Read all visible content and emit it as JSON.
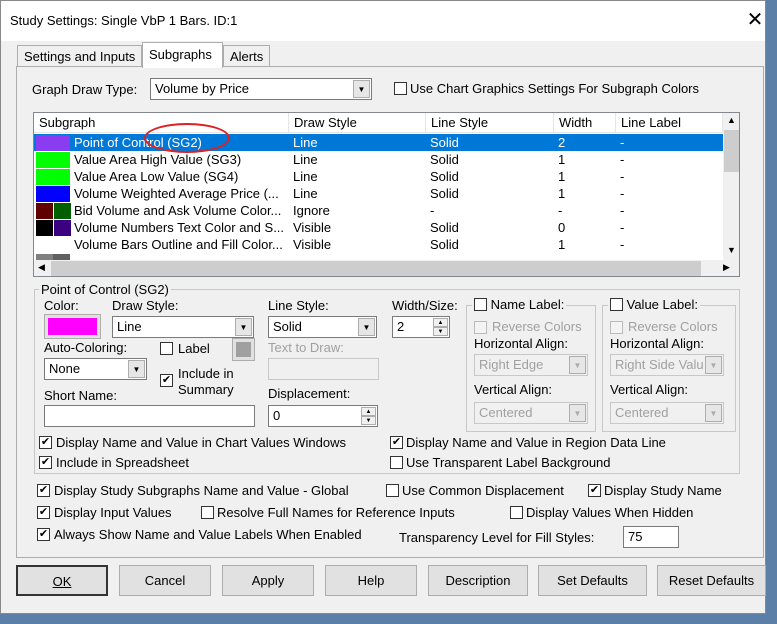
{
  "window": {
    "title": "Study Settings: Single VbP 1 Bars. ID:1"
  },
  "tabs": [
    {
      "label": "Settings and Inputs"
    },
    {
      "label": "Subgraphs",
      "selected": true
    },
    {
      "label": "Alerts"
    }
  ],
  "graph_draw_type": {
    "label": "Graph Draw Type:",
    "value": "Volume by Price"
  },
  "use_chart_graphics": {
    "label": "Use Chart Graphics Settings For Subgraph Colors",
    "checked": false
  },
  "list": {
    "columns": [
      "Subgraph",
      "Draw Style",
      "Line Style",
      "Width",
      "Line Label"
    ],
    "rows": [
      {
        "name": "Point of Control (SG2)",
        "draw": "Line",
        "line": "Solid",
        "width": "2",
        "label": "-",
        "colors": [
          "#8a3df0"
        ],
        "selected": true
      },
      {
        "name": "Value Area High Value (SG3)",
        "draw": "Line",
        "line": "Solid",
        "width": "1",
        "label": "-",
        "colors": [
          "#00ff00"
        ]
      },
      {
        "name": "Value Area Low Value (SG4)",
        "draw": "Line",
        "line": "Solid",
        "width": "1",
        "label": "-",
        "colors": [
          "#00ff00"
        ]
      },
      {
        "name": "Volume Weighted Average Price (...",
        "draw": "Line",
        "line": "Solid",
        "width": "1",
        "label": "-",
        "colors": [
          "#0000ff"
        ]
      },
      {
        "name": "Bid Volume and Ask Volume Color...",
        "draw": "Ignore",
        "line": "-",
        "width": "-",
        "label": "-",
        "colors": [
          "#600000",
          "#006000"
        ]
      },
      {
        "name": "Volume Numbers Text Color and S...",
        "draw": "Visible",
        "line": "Solid",
        "width": "0",
        "label": "-",
        "colors": [
          "#000000",
          "#3a0080"
        ]
      },
      {
        "name": "Volume Bars Outline and Fill Color...",
        "draw": "Visible",
        "line": "Solid",
        "width": "1",
        "label": "-",
        "colors": [
          "#ffffff",
          "#ffffff"
        ]
      }
    ]
  },
  "detail": {
    "group_title": "Point of Control (SG2)",
    "color_label": "Color:",
    "color": "#ff00ff",
    "draw_style_label": "Draw Style:",
    "draw_style": "Line",
    "line_style_label": "Line Style:",
    "line_style": "Solid",
    "width_label": "Width/Size:",
    "width": "2",
    "auto_coloring_label": "Auto-Coloring:",
    "auto_coloring": "None",
    "label_cb": "Label",
    "include_summary": "Include in Summary",
    "text_to_draw_label": "Text to Draw:",
    "short_name_label": "Short Name:",
    "short_name": "",
    "displacement_label": "Displacement:",
    "displacement": "0",
    "name_label": {
      "title": "Name Label:",
      "reverse": "Reverse Colors",
      "h_label": "Horizontal Align:",
      "h_value": "Right Edge",
      "v_label": "Vertical Align:",
      "v_value": "Centered"
    },
    "value_label": {
      "title": "Value Label:",
      "reverse": "Reverse Colors",
      "h_label": "Horizontal Align:",
      "h_value": "Right Side Valu",
      "v_label": "Vertical Align:",
      "v_value": "Centered"
    },
    "cb_chart_values": "Display Name and Value in Chart Values Windows",
    "cb_spreadsheet": "Include in Spreadsheet",
    "cb_region": "Display Name and Value in Region Data Line",
    "cb_transparent": "Use Transparent Label Background"
  },
  "global": {
    "display_subgraphs": "Display Study Subgraphs Name and Value - Global",
    "common_disp": "Use Common Displacement",
    "display_name": "Display Study Name",
    "input_values": "Display Input Values",
    "resolve": "Resolve Full Names for Reference Inputs",
    "when_hidden": "Display Values When Hidden",
    "always_show": "Always Show Name and Value Labels When Enabled",
    "transparency_label": "Transparency Level for Fill Styles:",
    "transparency": "75"
  },
  "buttons": {
    "ok": "OK",
    "cancel": "Cancel",
    "apply": "Apply",
    "help": "Help",
    "description": "Description",
    "set_defaults": "Set Defaults",
    "reset_defaults": "Reset Defaults"
  },
  "check": "✔",
  "arrow": "▼",
  "close": "✕"
}
